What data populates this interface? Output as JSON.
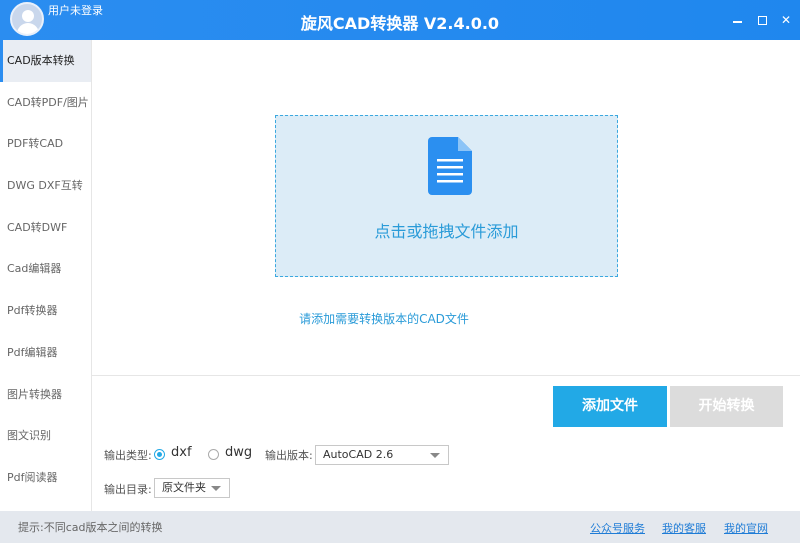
{
  "titlebar": {
    "user_label": "用户未登录",
    "app_title": "旋风CAD转换器 V2.4.0.0",
    "minimize_glyph": "",
    "maximize_glyph": "",
    "close_glyph": "✕"
  },
  "sidebar": {
    "items": [
      {
        "label": "CAD版本转换",
        "active": true
      },
      {
        "label": "CAD转PDF/图片"
      },
      {
        "label": "PDF转CAD"
      },
      {
        "label": "DWG DXF互转"
      },
      {
        "label": "CAD转DWF"
      },
      {
        "label": "Cad编辑器"
      },
      {
        "label": "Pdf转换器"
      },
      {
        "label": "Pdf编辑器"
      },
      {
        "label": "图片转换器"
      },
      {
        "label": "图文识别"
      },
      {
        "label": "Pdf阅读器"
      }
    ]
  },
  "main": {
    "dropzone_text": "点击或拖拽文件添加",
    "hint_text": "请添加需要转换版本的CAD文件",
    "add_button": "添加文件",
    "start_button": "开始转换",
    "output_type_label": "输出类型:",
    "output_type_options": [
      "dxf",
      "dwg"
    ],
    "output_type_selected": "dxf",
    "output_version_label": "输出版本:",
    "output_version_value": "AutoCAD 2.6",
    "output_dir_label": "输出目录:",
    "output_dir_value": "原文件夹"
  },
  "statusbar": {
    "tip": "提示:不同cad版本之间的转换",
    "links": [
      "公众号服务",
      "我的客服",
      "我的官网"
    ]
  },
  "colors": {
    "titlebar": "#2b8df0",
    "accent": "#22a9e6",
    "dropzone_bg": "#dcecf7",
    "disabled_button": "#dcdcdc",
    "statusbar": "#e4e8ee"
  }
}
